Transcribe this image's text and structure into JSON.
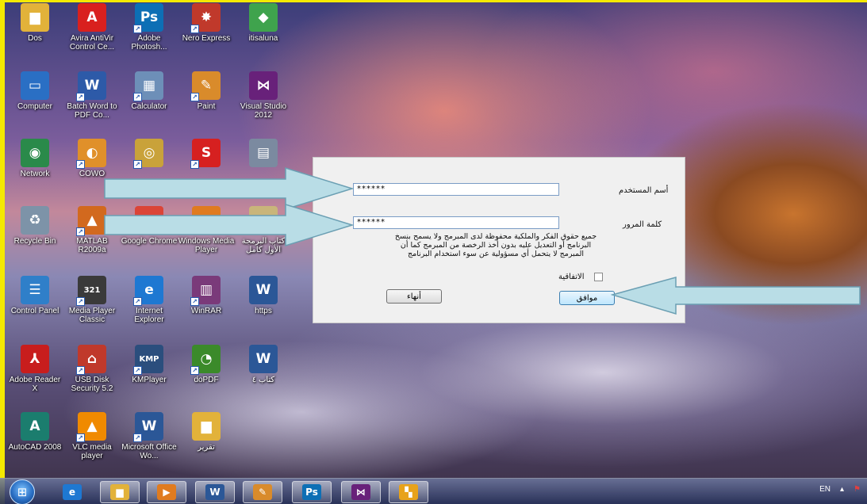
{
  "desktop": {
    "icons": [
      {
        "label": "Dos",
        "glyph": "▆",
        "color": "#e2b23a",
        "icon": "folder-icon",
        "shortcut": false
      },
      {
        "label": "Avira AntiVir Control Ce...",
        "glyph": "A",
        "color": "#d9201e",
        "icon": "avira-icon",
        "shortcut": false
      },
      {
        "label": "Adobe Photosh...",
        "glyph": "Ps",
        "color": "#0d6fb5",
        "icon": "photoshop-icon",
        "shortcut": true
      },
      {
        "label": "Nero Express",
        "glyph": "✸",
        "color": "#c0392b",
        "icon": "nero-icon",
        "shortcut": true
      },
      {
        "label": "itisaluna",
        "glyph": "◆",
        "color": "#3fa34d",
        "icon": "itisaluna-icon",
        "shortcut": false
      },
      {
        "label": "Computer",
        "glyph": "▭",
        "color": "#2a6fc4",
        "icon": "computer-icon",
        "shortcut": false
      },
      {
        "label": "Batch Word to PDF Co...",
        "glyph": "W",
        "color": "#2d5aa8",
        "icon": "batch-word-pdf-icon",
        "shortcut": true
      },
      {
        "label": "Calculator",
        "glyph": "▦",
        "color": "#6d8fb8",
        "icon": "calculator-icon",
        "shortcut": true
      },
      {
        "label": "Paint",
        "glyph": "✎",
        "color": "#d98b2b",
        "icon": "paint-icon",
        "shortcut": true
      },
      {
        "label": "Visual Studio 2012",
        "glyph": "⋈",
        "color": "#68217a",
        "icon": "visual-studio-icon",
        "shortcut": false
      },
      {
        "label": "Network",
        "glyph": "◉",
        "color": "#2a8a4a",
        "icon": "network-icon",
        "shortcut": false
      },
      {
        "label": "COWO",
        "glyph": "◐",
        "color": "#e0902a",
        "icon": "cowon-icon",
        "shortcut": true
      },
      {
        "label": "",
        "glyph": "◎",
        "color": "#c9a23a",
        "icon": "arabic-app-icon",
        "shortcut": true
      },
      {
        "label": "",
        "glyph": "S",
        "color": "#d62020",
        "icon": "s-app-icon",
        "shortcut": true
      },
      {
        "label": "",
        "glyph": "▤",
        "color": "#7b8aa0",
        "icon": "image-icon",
        "shortcut": false
      },
      {
        "label": "Recycle Bin",
        "glyph": "♻",
        "color": "#7d93a8",
        "icon": "recycle-bin-icon",
        "shortcut": false
      },
      {
        "label": "MATLAB R2009a",
        "glyph": "▲",
        "color": "#d2691e",
        "icon": "matlab-icon",
        "shortcut": true
      },
      {
        "label": "Google Chrome",
        "glyph": "◍",
        "color": "#db4437",
        "icon": "chrome-icon",
        "shortcut": false
      },
      {
        "label": "Windows Media Player",
        "glyph": "▶",
        "color": "#e07b1f",
        "icon": "media-player-icon",
        "shortcut": false
      },
      {
        "label": "كتاب البرمجة الأول كامل",
        "glyph": "▤",
        "color": "#c9b57a",
        "icon": "book-file-icon",
        "shortcut": false
      },
      {
        "label": "Control Panel",
        "glyph": "☰",
        "color": "#2f7fc9",
        "icon": "control-panel-icon",
        "shortcut": false
      },
      {
        "label": "Media Player Classic",
        "glyph": "321",
        "color": "#3a3a3a",
        "icon": "mpc-icon",
        "shortcut": true
      },
      {
        "label": "Internet Explorer",
        "glyph": "e",
        "color": "#1e78d2",
        "icon": "internet-explorer-icon",
        "shortcut": true
      },
      {
        "label": "WinRAR",
        "glyph": "▥",
        "color": "#7a3a7a",
        "icon": "winrar-icon",
        "shortcut": true
      },
      {
        "label": "https",
        "glyph": "W",
        "color": "#2b5797",
        "icon": "word-document-icon",
        "shortcut": false
      },
      {
        "label": "Adobe Reader X",
        "glyph": "⅄",
        "color": "#c81d1d",
        "icon": "adobe-reader-icon",
        "shortcut": false
      },
      {
        "label": "USB Disk Security 5.2",
        "glyph": "⌂",
        "color": "#c0392b",
        "icon": "usb-security-icon",
        "shortcut": true
      },
      {
        "label": "KMPlayer",
        "glyph": "KMP",
        "color": "#2b4e7d",
        "icon": "kmplayer-icon",
        "shortcut": true
      },
      {
        "label": "doPDF",
        "glyph": "◔",
        "color": "#3b8a2a",
        "icon": "dopdf-icon",
        "shortcut": true
      },
      {
        "label": "كتاب ٤",
        "glyph": "W",
        "color": "#2b5797",
        "icon": "word-document-icon",
        "shortcut": false
      },
      {
        "label": "AutoCAD 2008",
        "glyph": "A",
        "color": "#1b7d6e",
        "icon": "autocad-icon",
        "shortcut": false
      },
      {
        "label": "VLC media player",
        "glyph": "▲",
        "color": "#f08a00",
        "icon": "vlc-icon",
        "shortcut": true
      },
      {
        "label": "Microsoft Office Wo...",
        "glyph": "W",
        "color": "#2b5797",
        "icon": "ms-word-icon",
        "shortcut": true
      },
      {
        "label": "تقرير",
        "glyph": "▆",
        "color": "#e2b23a",
        "icon": "folder-icon",
        "shortcut": false
      }
    ]
  },
  "dialog": {
    "username_label": "أسم المستخدم",
    "username_value": "******",
    "password_label": "كلمة المرور",
    "password_value": "******",
    "notice": "جميع حقوق الفكر والملكية محفوظة لدى المبرمج ولا يسمح بنسخ البرنامج أو التعديل عليه بدون أخذ الرخصة من المبرمج كما أن المبرمج لا يتحمل أي مسؤولية عن سوء استخدام البرنامج",
    "agreement_label": "الاتفاقية",
    "ok_label": "موافق",
    "exit_label": "أنهاء"
  },
  "taskbar": {
    "items": [
      {
        "icon": "internet-explorer-icon",
        "glyph": "e",
        "color": "#1e78d2"
      },
      {
        "icon": "file-explorer-icon",
        "glyph": "▆",
        "color": "#e2b23a"
      },
      {
        "icon": "media-player-icon",
        "glyph": "▶",
        "color": "#e07b1f"
      },
      {
        "icon": "word-icon",
        "glyph": "W",
        "color": "#2b5797"
      },
      {
        "icon": "paint-icon",
        "glyph": "✎",
        "color": "#d98b2b"
      },
      {
        "icon": "photoshop-icon",
        "glyph": "Ps",
        "color": "#0d6fb5"
      },
      {
        "icon": "visual-studio-icon",
        "glyph": "⋈",
        "color": "#68217a"
      },
      {
        "icon": "app-window-icon",
        "glyph": "▚",
        "color": "#e8a21a"
      }
    ],
    "language": "EN"
  },
  "colors": {
    "strip": "#f4e900",
    "hint_arrow_fill": "#b9dde6",
    "hint_arrow_stroke": "#6b9fb3"
  }
}
